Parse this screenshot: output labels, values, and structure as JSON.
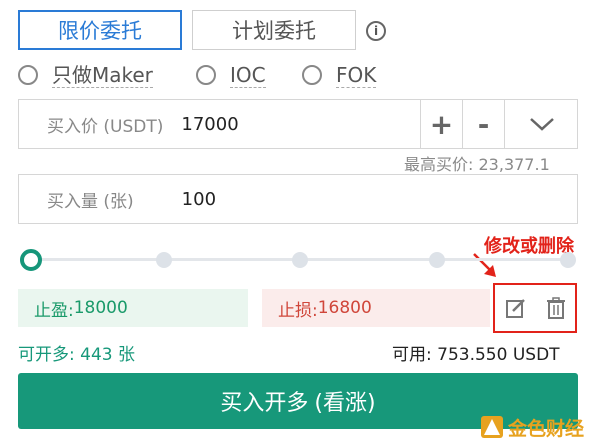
{
  "tabs": {
    "limit_label": "限价委托",
    "plan_label": "计划委托"
  },
  "info_icon": "info-icon",
  "order_types": [
    {
      "label": "只做Maker"
    },
    {
      "label": "IOC"
    },
    {
      "label": "FOK"
    }
  ],
  "price": {
    "label": "买入价 (USDT)",
    "value": "17000",
    "plus": "+",
    "minus": "-"
  },
  "max_bid": {
    "label": "最高买价:",
    "value": "23,377.1"
  },
  "quantity": {
    "label": "买入量 (张)",
    "value": "100"
  },
  "slider": {
    "level_percent": 0
  },
  "take_profit": {
    "label": "止盈:",
    "value": "18000"
  },
  "stop_loss": {
    "label": "止损:",
    "value": "16800"
  },
  "annotation": "修改或删除",
  "open_long": {
    "label": "可开多:",
    "value": "443",
    "unit": "张"
  },
  "available": {
    "label": "可用:",
    "value": "753.550",
    "unit": "USDT"
  },
  "buy_button": {
    "label": "买入开多",
    "sub": "(看涨)"
  },
  "watermark": "金色财经",
  "colors": {
    "accent_blue": "#2a7bd6",
    "green": "#17987a",
    "red": "#e2231a"
  }
}
